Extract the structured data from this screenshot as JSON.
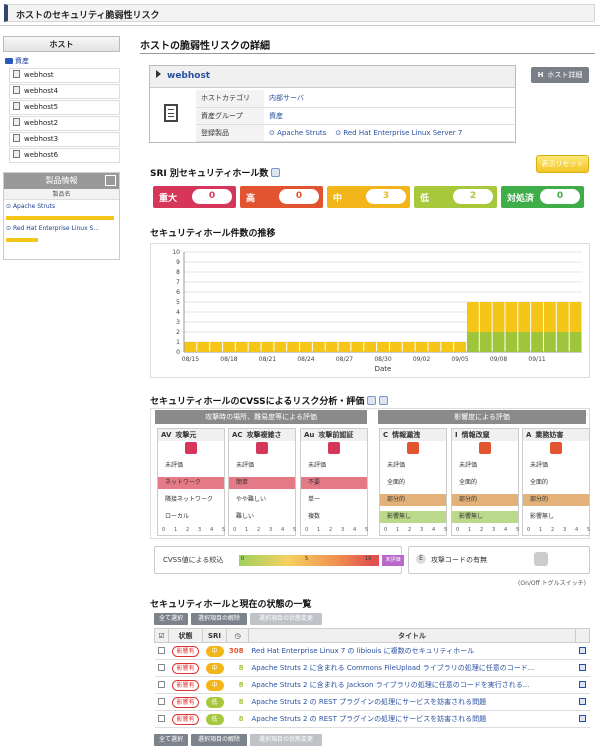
{
  "page_title": "ホストのセキュリティ脆弱性リスク",
  "sidebar": {
    "host_header": "ホスト",
    "assets_folder": "資産",
    "hosts": [
      "webhost",
      "webhost4",
      "webhost5",
      "webhost2",
      "webhost3",
      "webhost6"
    ],
    "product_header": "製品情報",
    "product_col": "製品名",
    "products": [
      {
        "name": "Apache Struts",
        "level": 1.0
      },
      {
        "name": "Red Hat Enterprise Linux S...",
        "level": 0.3
      }
    ]
  },
  "main": {
    "title": "ホストの脆弱性リスクの詳細",
    "host_name": "webhost",
    "host_detail_button": "ホスト詳細",
    "host_detail_icon": "H",
    "rows": {
      "category_label": "ホストカテゴリ",
      "category_value": "内部サーバ",
      "group_label": "資産グループ",
      "group_value": "資産",
      "products_label": "登録製品",
      "product_1": "Apache Struts",
      "product_2": "Red Hat Enterprise Linux Server 7"
    },
    "reset_button": "表示リセット"
  },
  "sri": {
    "heading": "SRI 別セキュリティホール数",
    "badges": [
      {
        "label": "重大",
        "count": "0",
        "color": "#d6365a"
      },
      {
        "label": "高",
        "count": "0",
        "color": "#e2532f"
      },
      {
        "label": "中",
        "count": "3",
        "color": "#f3b61a"
      },
      {
        "label": "低",
        "count": "2",
        "color": "#a7c83b"
      },
      {
        "label": "対処済",
        "count": "0",
        "color": "#3fae49"
      }
    ]
  },
  "trend": {
    "heading": "セキュリティホール件数の推移"
  },
  "chart_data": {
    "type": "bar",
    "stacked": true,
    "xlabel": "Date",
    "ylim": [
      0,
      10
    ],
    "yticks": [
      "0",
      "1",
      "2",
      "3",
      "4",
      "5",
      "6",
      "7",
      "8",
      "9",
      "10"
    ],
    "tick_labels": [
      "08/15",
      "08/18",
      "08/21",
      "08/24",
      "08/27",
      "08/30",
      "09/02",
      "09/05",
      "09/08",
      "09/11"
    ],
    "days": 31,
    "series": [
      {
        "color": "#f5c518",
        "values": [
          1,
          1,
          1,
          1,
          1,
          1,
          1,
          1,
          1,
          1,
          1,
          1,
          1,
          1,
          1,
          1,
          1,
          1,
          1,
          1,
          1,
          1,
          3,
          3,
          3,
          3,
          3,
          3,
          3,
          3,
          3
        ]
      },
      {
        "color": "#9fc53b",
        "values": [
          0,
          0,
          0,
          0,
          0,
          0,
          0,
          0,
          0,
          0,
          0,
          0,
          0,
          0,
          0,
          0,
          0,
          0,
          0,
          0,
          0,
          0,
          2,
          2,
          2,
          2,
          2,
          2,
          2,
          2,
          2
        ]
      }
    ]
  },
  "cvss": {
    "heading": "セキュリティホールのCVSSによるリスク分析・評価",
    "group1": "攻撃時の場所、難易度等による評価",
    "group2": "影響度による評価",
    "metrics": [
      {
        "abbr": "AV",
        "name": "攻撃元",
        "color": "#d6365a",
        "options": [
          "未評価",
          "ネットワーク",
          "隣接ネットワーク",
          "ローカル"
        ],
        "sel": 1,
        "selColor": "#e37a86"
      },
      {
        "abbr": "AC",
        "name": "攻撃複雑さ",
        "color": "#d6365a",
        "options": [
          "未評価",
          "簡単",
          "やや難しい",
          "難しい"
        ],
        "sel": 1,
        "selColor": "#e37a86"
      },
      {
        "abbr": "Au",
        "name": "攻撃前認証",
        "color": "#d6365a",
        "options": [
          "未評価",
          "不要",
          "単一",
          "複数"
        ],
        "sel": 1,
        "selColor": "#e37a86"
      },
      {
        "abbr": "C",
        "name": "情報漏洩",
        "color": "#e2532f",
        "options": [
          "未評価",
          "全面的",
          "部分的",
          "影響無し"
        ],
        "sel": 2,
        "selColor": "#e3b27a",
        "sel2": 3,
        "sel2Color": "#bcd88a"
      },
      {
        "abbr": "I",
        "name": "情報改竄",
        "color": "#e2532f",
        "options": [
          "未評価",
          "全面的",
          "部分的",
          "影響無し"
        ],
        "sel": 2,
        "selColor": "#e3b27a",
        "sel2": 3,
        "sel2Color": "#bcd88a"
      },
      {
        "abbr": "A",
        "name": "業務妨害",
        "color": "#e2532f",
        "options": [
          "未評価",
          "全面的",
          "部分的",
          "影響無し"
        ],
        "sel": 2,
        "selColor": "#e3b27a"
      }
    ],
    "scale": [
      "0",
      "1",
      "2",
      "3",
      "4",
      "5"
    ],
    "filter_label": "CVSS値による絞込",
    "filter_ticks": [
      "0",
      "5",
      "10"
    ],
    "unrated": "未評価",
    "exploit_abbr": "E",
    "exploit_label": "攻撃コードの有無",
    "toggle_note": "(On/Off トグルスイッチ)"
  },
  "vulns": {
    "heading": "セキュリティホールと現在の状態の一覧",
    "btn_select_all": "全て選択",
    "btn_clear": "選択項目の解除",
    "btn_change": "選択項目の状態変更",
    "col_status": "状態",
    "col_sri": "SRI",
    "col_title": "タイトル",
    "rows": [
      {
        "status": "影響有",
        "sri": "中",
        "sriColor": "#f3b61a",
        "count": "308",
        "countColor": "#e2532f",
        "title": "Red Hat Enterprise Linux 7 の libiouis に複数のセキュリティホール"
      },
      {
        "status": "影響有",
        "sri": "中",
        "sriColor": "#f3b61a",
        "count": "8",
        "countColor": "#a7c83b",
        "title": "Apache Struts 2 に含まれる Commons FileUpload ライブラリの処理に任意のコード..."
      },
      {
        "status": "影響有",
        "sri": "中",
        "sriColor": "#f3b61a",
        "count": "8",
        "countColor": "#a7c83b",
        "title": "Apache Struts 2 に含まれる Jackson ライブラリの処理に任意のコードを実行される..."
      },
      {
        "status": "影響有",
        "sri": "低",
        "sriColor": "#a7c83b",
        "count": "8",
        "countColor": "#a7c83b",
        "title": "Apache Struts 2 の REST プラグインの処理にサービスを妨害される問題"
      },
      {
        "status": "影響有",
        "sri": "低",
        "sriColor": "#a7c83b",
        "count": "8",
        "countColor": "#a7c83b",
        "title": "Apache Struts 2 の REST プラグインの処理にサービスを妨害される問題"
      }
    ]
  }
}
